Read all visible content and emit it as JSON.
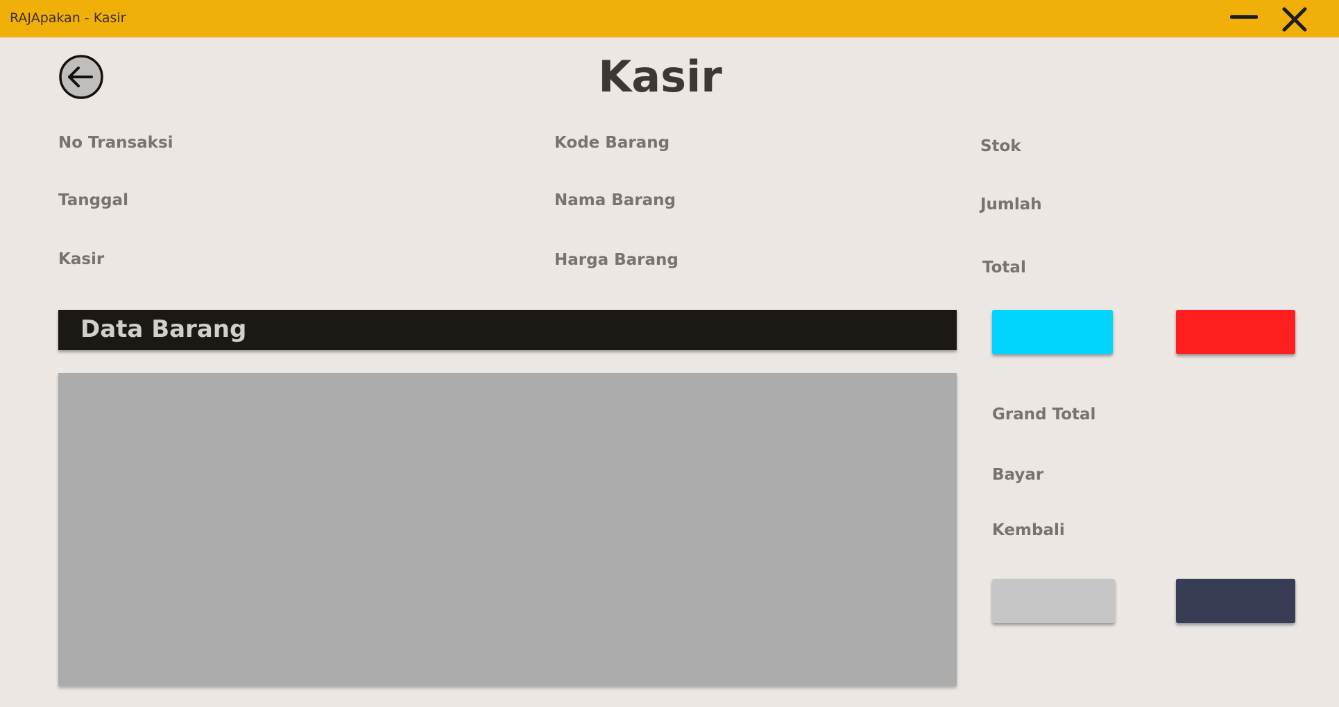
{
  "window": {
    "title": "RAJApakan - Kasir",
    "bar_color": "#f0af09",
    "minimize_icon": "minimize-icon",
    "close_icon": "close-icon"
  },
  "header": {
    "back_icon": "arrow-left-circle-icon",
    "title": "Kasir"
  },
  "form": {
    "no_transaksi_label": "No Transaksi",
    "tanggal_label": "Tanggal",
    "kasir_label": "Kasir",
    "kode_barang_label": "Kode Barang",
    "nama_barang_label": "Nama Barang",
    "harga_barang_label": "Harga Barang",
    "stok_label": "Stok",
    "jumlah_label": "Jumlah",
    "total_label": "Total"
  },
  "data_section": {
    "title": "Data Barang"
  },
  "summary": {
    "grand_total_label": "Grand Total",
    "bayar_label": "Bayar",
    "kembali_label": "Kembali"
  },
  "buttons": {
    "cyan_color": "#00d4ff",
    "red_color": "#ff1f1f",
    "gray_color": "#c6c6c6",
    "navy_color": "#373d55"
  }
}
